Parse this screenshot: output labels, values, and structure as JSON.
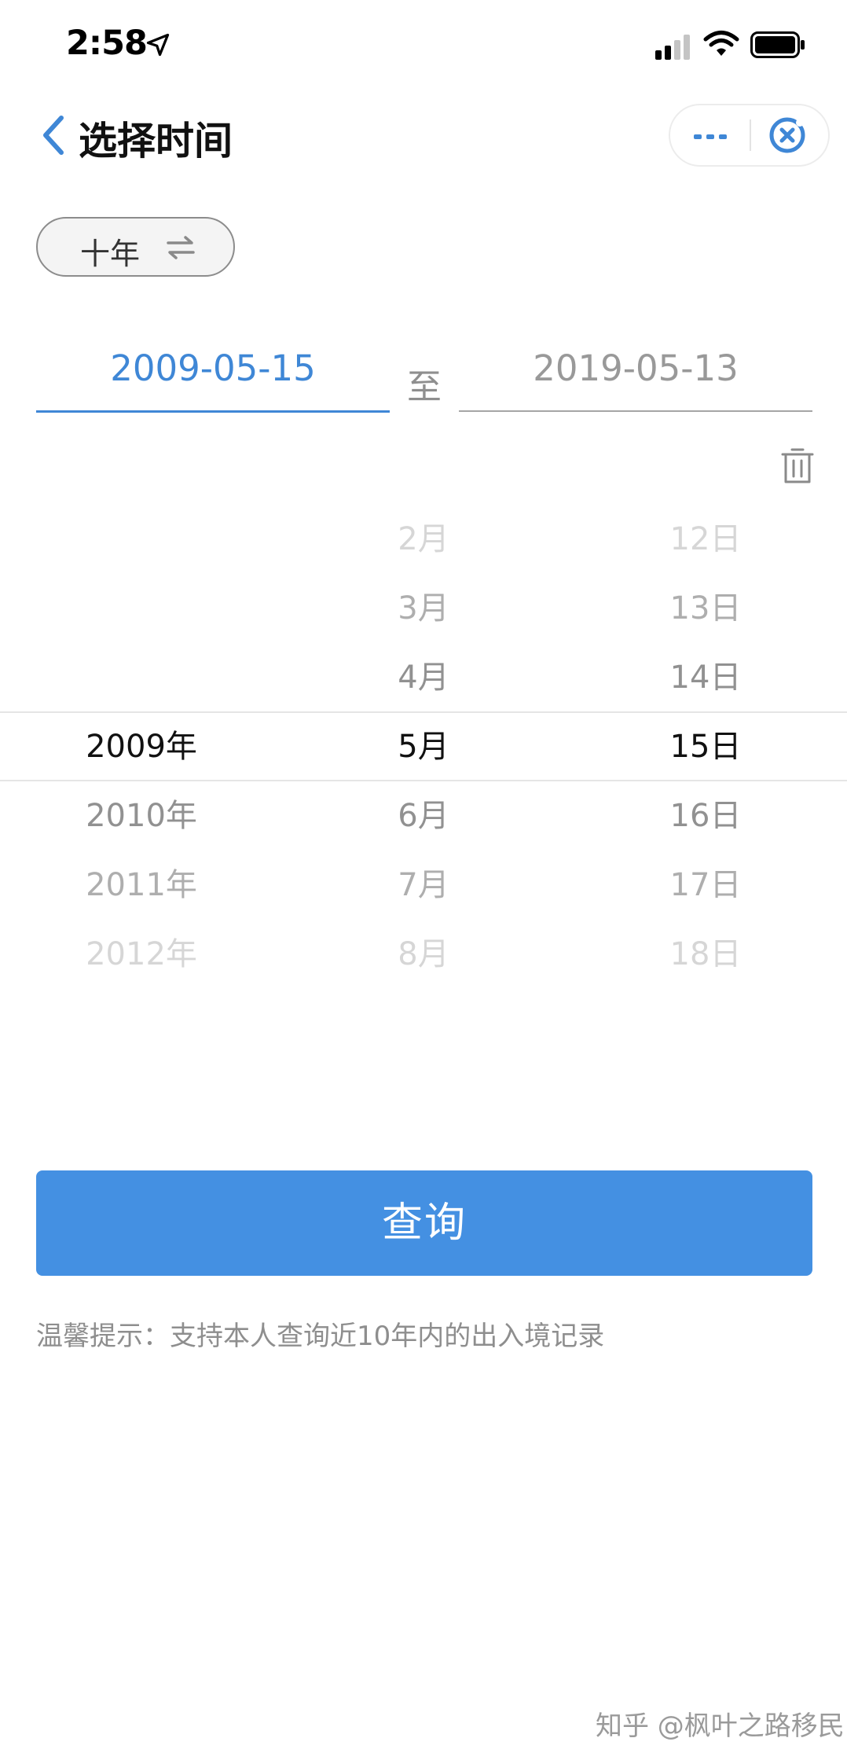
{
  "status_bar": {
    "time": "2:58"
  },
  "header": {
    "title": "选择时间"
  },
  "range_toggle": {
    "label": "十年"
  },
  "date_range": {
    "start": "2009-05-15",
    "separator": "至",
    "end": "2019-05-13"
  },
  "picker": {
    "years": [
      "2009年",
      "2010年",
      "2011年",
      "2012年"
    ],
    "months": [
      "2月",
      "3月",
      "4月",
      "5月",
      "6月",
      "7月",
      "8月"
    ],
    "days": [
      "12日",
      "13日",
      "14日",
      "15日",
      "16日",
      "17日",
      "18日"
    ]
  },
  "query_button": {
    "label": "查询"
  },
  "tip": {
    "text": "温馨提示：支持本人查询近10年内的出入境记录"
  },
  "watermark": {
    "text": "知乎 @枫叶之路移民"
  },
  "colors": {
    "accent": "#4490e2",
    "active_date": "#3f87d6"
  }
}
